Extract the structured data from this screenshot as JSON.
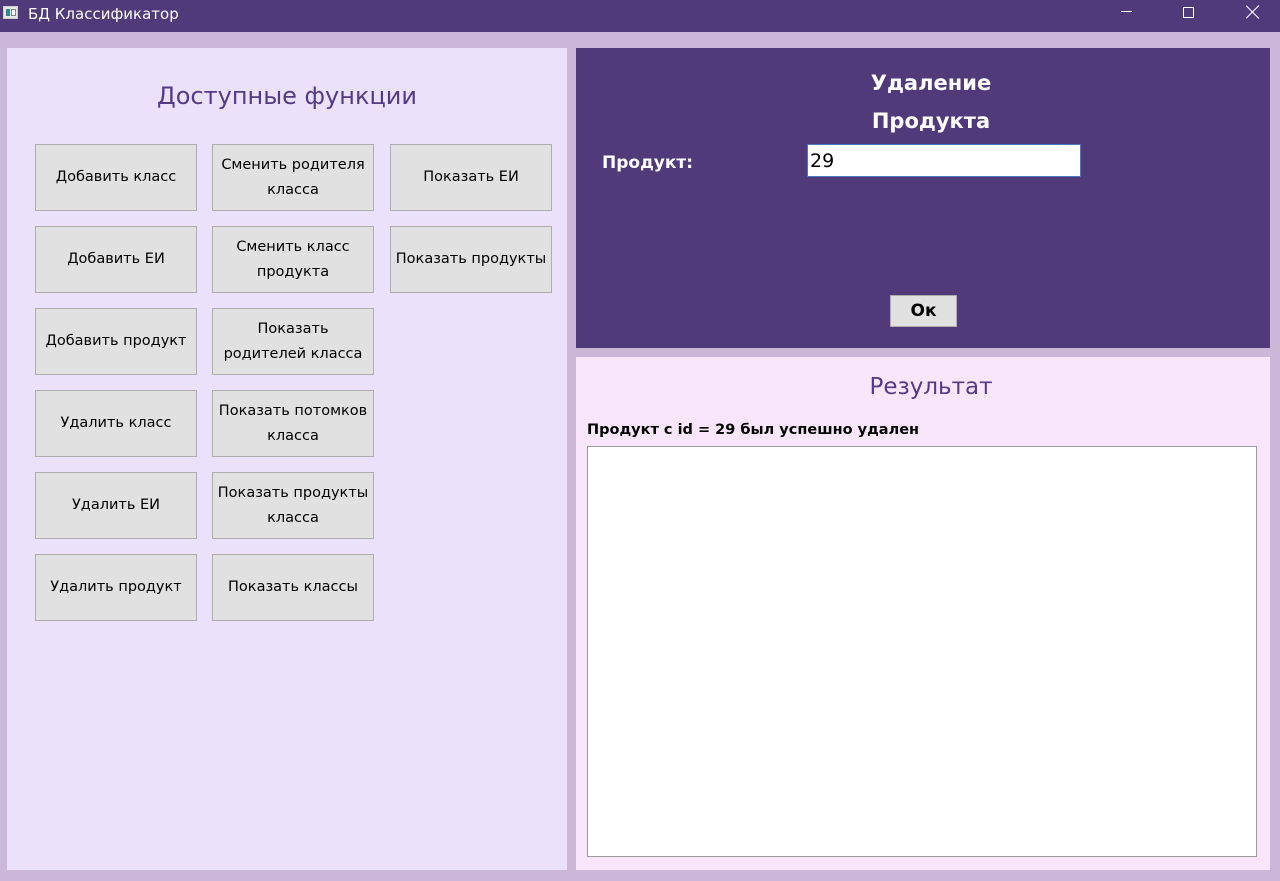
{
  "window": {
    "title": "БД Классификатор"
  },
  "functions": {
    "heading": "Доступные функции",
    "buttons": [
      "Добавить класс",
      "Сменить родителя\nкласса",
      "Показать ЕИ",
      "Добавить ЕИ",
      "Сменить класс\nпродукта",
      "Показать продукты",
      "Добавить продукт",
      "Показать\nродителей класса",
      "Удалить класс",
      "Показать потомков\nкласса",
      "Удалить ЕИ",
      "Показать продукты\nкласса",
      "Удалить продукт",
      "Показать классы"
    ]
  },
  "delete_form": {
    "title_line1": "Удаление",
    "title_line2": "Продукта",
    "product_label": "Продукт:",
    "product_value": "29",
    "ok_label": "Ок"
  },
  "result": {
    "title": "Результат",
    "status": "Продукт с id = 29 был успешно удален",
    "output": ""
  },
  "colors": {
    "titlebar": "#513a7a",
    "left_panel": "#ebe1fb",
    "result_panel": "#fae6fb",
    "accent_text": "#553a85"
  }
}
